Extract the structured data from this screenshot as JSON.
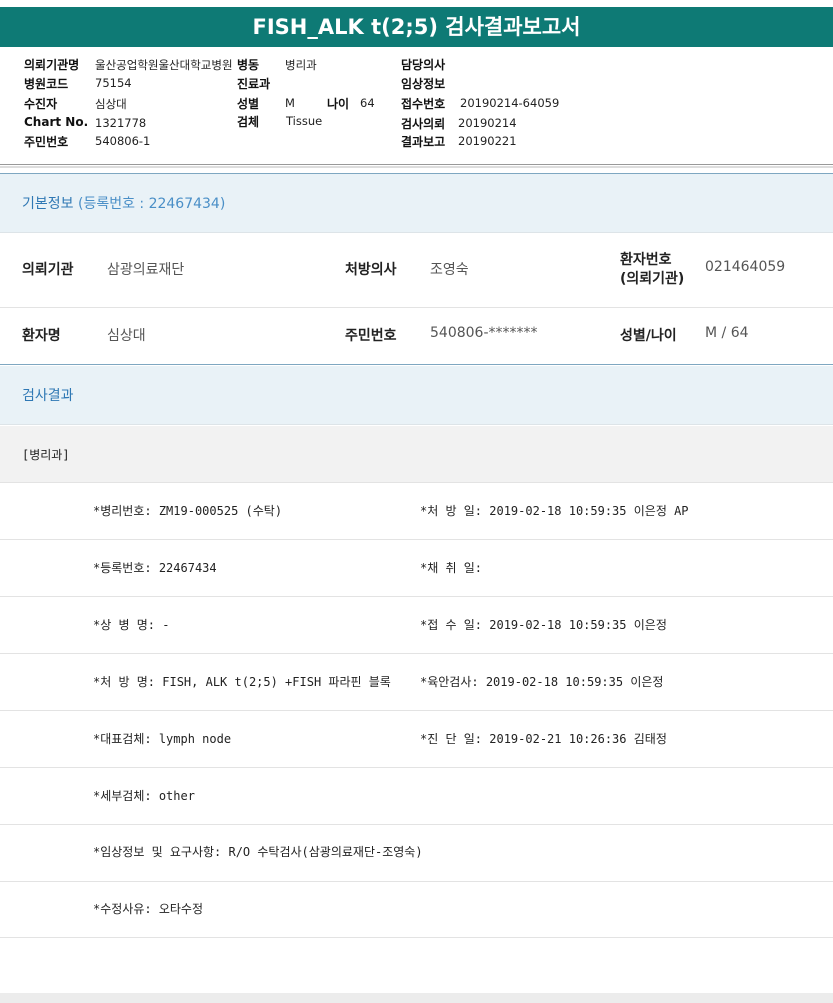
{
  "report": {
    "title": "FISH_ALK t(2;5) 검사결과보고서",
    "header": {
      "institution_label": "의뢰기관명",
      "institution_value": "울산공업학원울산대학교병원",
      "ward_label": "병동",
      "ward_value": "병리과",
      "doctor_label": "담당의사",
      "doctor_value": "",
      "hospital_code_label": "병원코드",
      "hospital_code_value": "75154",
      "dept_label": "진료과",
      "dept_value": "",
      "clinical_label": "임상정보",
      "clinical_value": "",
      "recipient_label": "수진자",
      "recipient_value": "심상대",
      "sex_label": "성별",
      "sex_value": "M",
      "age_label": "나이",
      "age_value": "64",
      "accession_label": "접수번호",
      "accession_value": "20190214-64059",
      "chart_label": "Chart No.",
      "chart_value": "1321778",
      "specimen_label": "검체",
      "specimen_value": "Tissue",
      "request_label": "검사의뢰",
      "request_value": "20190214",
      "rrn_label": "주민번호",
      "rrn_value": "540806-1",
      "result_report_label": "결과보고",
      "result_report_value": "20190221"
    }
  },
  "basic_info": {
    "heading": "기본정보",
    "reg_note": "(등록번호 : 22467434)",
    "requesting_org_label": "의뢰기관",
    "requesting_org_value": "삼광의료재단",
    "prescriber_label": "처방의사",
    "prescriber_value": "조영숙",
    "patient_no_label_1": "환자번호",
    "patient_no_label_2": "(의뢰기관)",
    "patient_no_value": "021464059",
    "patient_name_label": "환자명",
    "patient_name_value": "심상대",
    "rrn_label": "주민번호",
    "rrn_value": "540806-*******",
    "sex_age_label": "성별/나이",
    "sex_age_value": "M / 64"
  },
  "results": {
    "heading": "검사결과",
    "dept": "[병리과]",
    "rows": [
      {
        "left": "*병리번호: ZM19-000525 (수탁)",
        "right": "*처 방 일: 2019-02-18 10:59:35  이은정 AP"
      },
      {
        "left": "*등록번호: 22467434",
        "right": "*채 취 일:"
      },
      {
        "left": "*상 병 명: -",
        "right": "*접 수 일: 2019-02-18 10:59:35  이은정"
      },
      {
        "left": "*처 방 명: FISH, ALK t(2;5) +FISH 파라핀 블록",
        "right": "*육안검사: 2019-02-18 10:59:35  이은정"
      },
      {
        "left": "*대표검체: lymph node",
        "right": "*진 단 일: 2019-02-21 10:26:36  김태정"
      },
      {
        "left": "*세부검체: other",
        "right": ""
      },
      {
        "left": "*임상정보 및 요구사항: R/O 수탁검사(삼광의료재단-조영숙)",
        "right": ""
      },
      {
        "left": "*수정사유: 오타수정",
        "right": ""
      }
    ]
  },
  "colors": {
    "title_bg": "#0e7a75",
    "section_heading": "#2f78b4",
    "section_bg": "#e9f2f7"
  }
}
